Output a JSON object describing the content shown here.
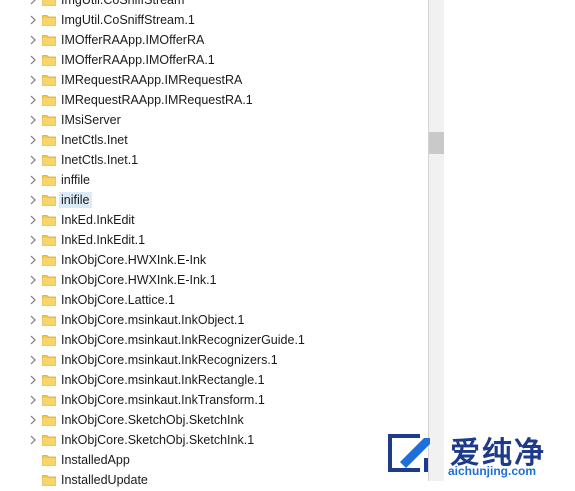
{
  "tree": {
    "items": [
      {
        "label": "ImgUtil.CoSniffStream",
        "expandable": true
      },
      {
        "label": "ImgUtil.CoSniffStream.1",
        "expandable": true
      },
      {
        "label": "IMOfferRAApp.IMOfferRA",
        "expandable": true
      },
      {
        "label": "IMOfferRAApp.IMOfferRA.1",
        "expandable": true
      },
      {
        "label": "IMRequestRAApp.IMRequestRA",
        "expandable": true
      },
      {
        "label": "IMRequestRAApp.IMRequestRA.1",
        "expandable": true
      },
      {
        "label": "IMsiServer",
        "expandable": true
      },
      {
        "label": "InetCtls.Inet",
        "expandable": true
      },
      {
        "label": "InetCtls.Inet.1",
        "expandable": true
      },
      {
        "label": "inffile",
        "expandable": true
      },
      {
        "label": "inifile",
        "expandable": true,
        "selected": true
      },
      {
        "label": "InkEd.InkEdit",
        "expandable": true
      },
      {
        "label": "InkEd.InkEdit.1",
        "expandable": true
      },
      {
        "label": "InkObjCore.HWXInk.E-Ink",
        "expandable": true
      },
      {
        "label": "InkObjCore.HWXInk.E-Ink.1",
        "expandable": true
      },
      {
        "label": "InkObjCore.Lattice.1",
        "expandable": true
      },
      {
        "label": "InkObjCore.msinkaut.InkObject.1",
        "expandable": true
      },
      {
        "label": "InkObjCore.msinkaut.InkRecognizerGuide.1",
        "expandable": true
      },
      {
        "label": "InkObjCore.msinkaut.InkRecognizers.1",
        "expandable": true
      },
      {
        "label": "InkObjCore.msinkaut.InkRectangle.1",
        "expandable": true
      },
      {
        "label": "InkObjCore.msinkaut.InkTransform.1",
        "expandable": true
      },
      {
        "label": "InkObjCore.SketchObj.SketchInk",
        "expandable": true
      },
      {
        "label": "InkObjCore.SketchObj.SketchInk.1",
        "expandable": true
      },
      {
        "label": "InstalledApp",
        "expandable": false
      },
      {
        "label": "InstalledUpdate",
        "expandable": false
      }
    ]
  },
  "watermark": {
    "cn": "爱纯净",
    "en": "aichunjing.com"
  },
  "colors": {
    "folder": "#f2c94c",
    "folder_edge": "#d9a82a",
    "selection": "#dbeaf7",
    "watermark_blue": "#1e6fd9"
  }
}
